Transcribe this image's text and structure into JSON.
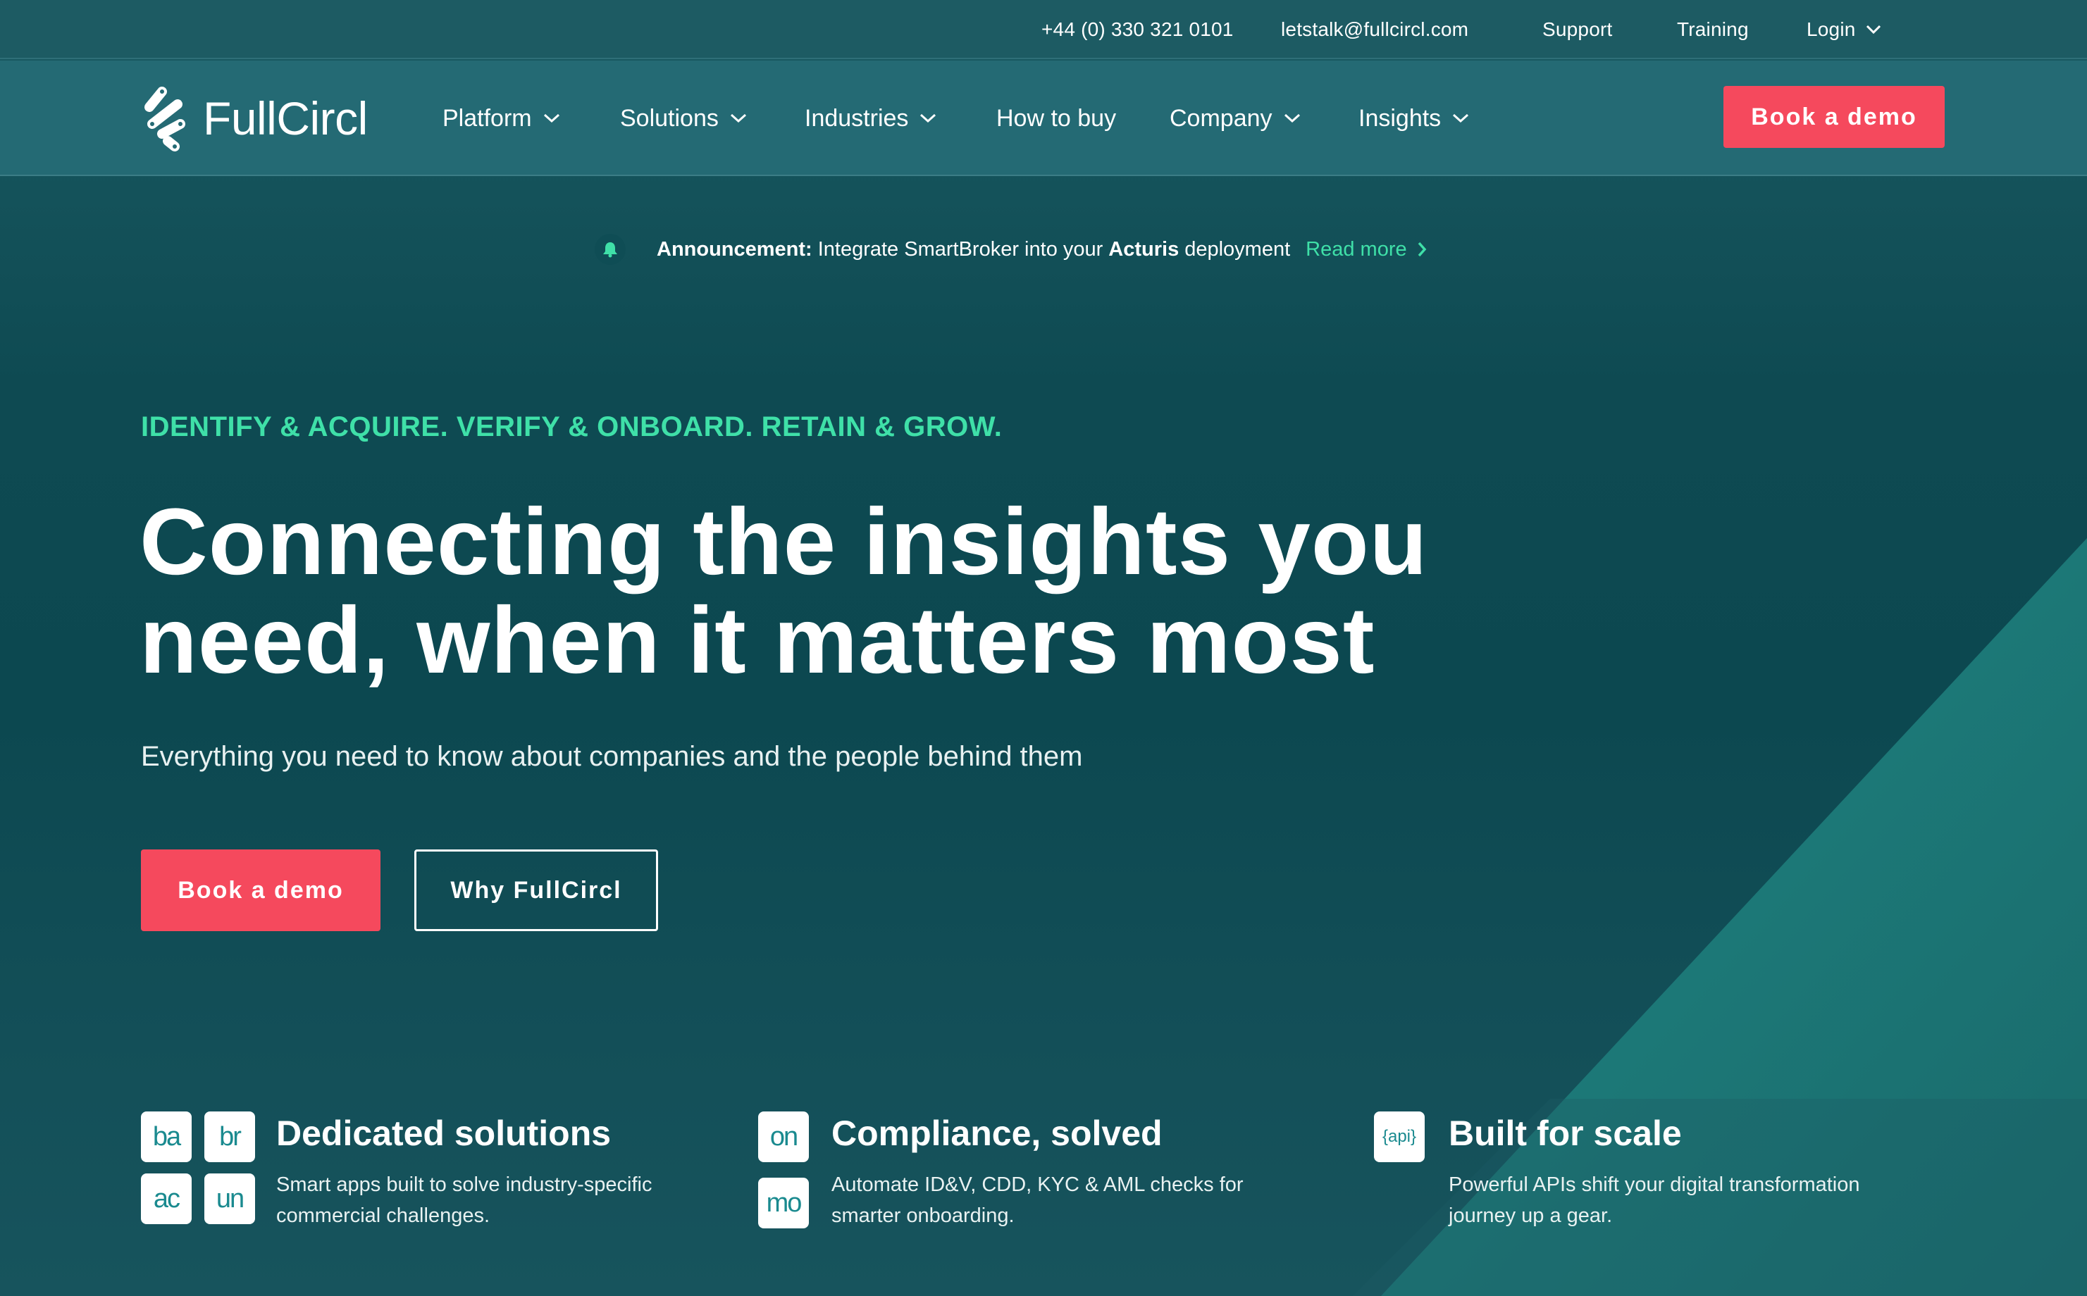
{
  "topbar": {
    "phone": "+44 (0) 330 321 0101",
    "email": "letstalk@fullcircl.com",
    "support": "Support",
    "training": "Training",
    "login": "Login"
  },
  "nav": {
    "brand": "FullCircl",
    "items": [
      {
        "label": "Platform"
      },
      {
        "label": "Solutions"
      },
      {
        "label": "Industries"
      },
      {
        "label": "How to buy"
      },
      {
        "label": "Company"
      },
      {
        "label": "Insights"
      }
    ],
    "cta": "Book a demo"
  },
  "announcement": {
    "prefix": "Announcement:",
    "text_a": "Integrate SmartBroker into your",
    "bold": "Acturis",
    "text_b": "deployment",
    "link": "Read more"
  },
  "hero": {
    "eyebrow": "IDENTIFY & ACQUIRE. VERIFY & ONBOARD. RETAIN & GROW.",
    "headline_line1": "Connecting the insights you",
    "headline_line2": "need, when it matters most",
    "subhead": "Everything you need to know about companies and the people behind them",
    "primary_cta": "Book a demo",
    "secondary_cta": "Why FullCircl"
  },
  "features": [
    {
      "title": "Dedicated solutions",
      "desc_line1": "Smart apps built to solve industry-specific",
      "desc_line2": "commercial challenges.",
      "tiles": [
        "ba",
        "br",
        "ac",
        "un"
      ]
    },
    {
      "title": "Compliance, solved",
      "desc_line1": "Automate ID&V, CDD, KYC & AML checks for",
      "desc_line2": "smarter onboarding.",
      "tiles": [
        "on",
        "mo"
      ]
    },
    {
      "title": "Built for scale",
      "desc_line1": "Powerful APIs shift your digital transformation",
      "desc_line2": "journey up a gear.",
      "tiles": [
        "{api}"
      ]
    }
  ],
  "colors": {
    "accent_green": "#3fe0a8",
    "cta_red": "#f5495d",
    "nav_bg": "#246a74",
    "topbar_bg": "#1d5b63"
  }
}
